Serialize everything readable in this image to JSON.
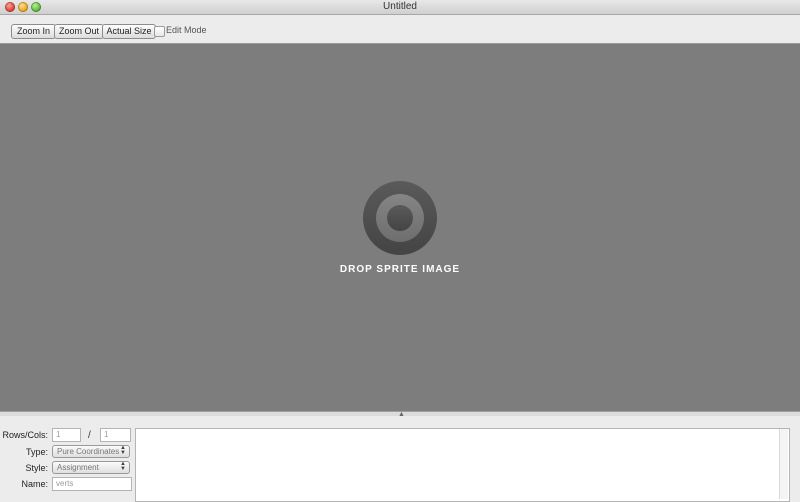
{
  "window": {
    "title": "Untitled"
  },
  "toolbar": {
    "zoom_in": "Zoom In",
    "zoom_out": "Zoom Out",
    "actual_size": "Actual Size",
    "edit_mode": {
      "label": "Edit Mode",
      "checked": false
    }
  },
  "canvas": {
    "drop_text": "DROP SPRITE IMAGE",
    "icon": "target-icon",
    "background": "#7d7d7d"
  },
  "panel": {
    "rows_cols_label": "Rows/Cols:",
    "rows_value": "1",
    "separator": "/",
    "cols_value": "1",
    "type_label": "Type:",
    "type_value": "Pure Coordinates",
    "style_label": "Style:",
    "style_value": "Assignment",
    "name_label": "Name:",
    "name_value": "verts",
    "output_text": ""
  }
}
